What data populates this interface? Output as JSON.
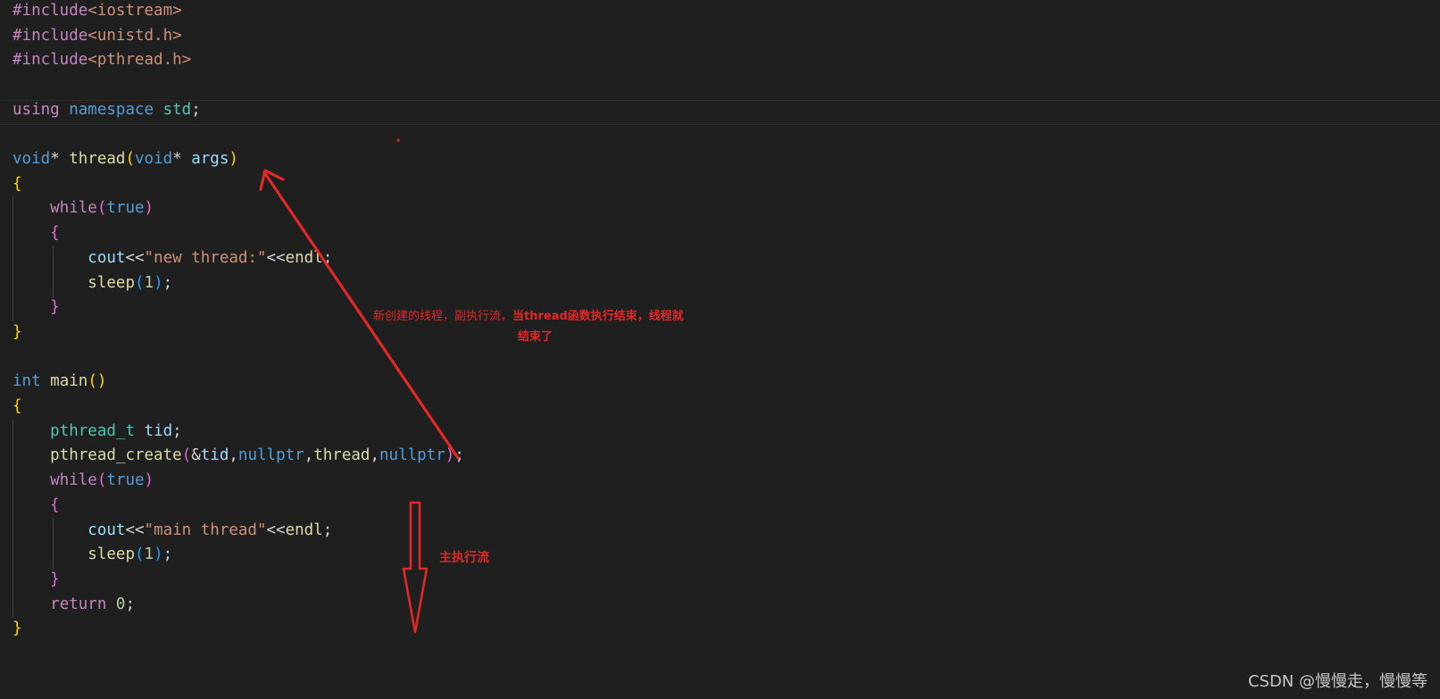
{
  "code": {
    "l1_kw": "#include",
    "l1_hdr": "<iostream>",
    "l2_kw": "#include",
    "l2_hdr": "<unistd.h>",
    "l3_kw": "#include",
    "l3_hdr": "<pthread.h>",
    "l5_using": "using",
    "l5_namespace": "namespace",
    "l5_std": "std",
    "l5_semi": ";",
    "l7_void1": "void",
    "l7_star1": "* ",
    "l7_thread": "thread",
    "l7_paren_open": "(",
    "l7_void2": "void",
    "l7_star2": "* ",
    "l7_args": "args",
    "l7_paren_close": ")",
    "brace_open": "{",
    "brace_close": "}",
    "while": "while",
    "true": "true",
    "paren_open": "(",
    "paren_close": ")",
    "cout": "cout",
    "shl": "<<",
    "str_new_thread": "\"new thread:\"",
    "endl": "endl",
    "semi": ";",
    "sleep": "sleep",
    "one": "1",
    "int": "int",
    "main": "main",
    "main_parens": "()",
    "pthread_t": "pthread_t",
    "tid": "tid",
    "pthread_create": "pthread_create",
    "amp": "&",
    "comma": ",",
    "nullptr": "nullptr",
    "thread": "thread",
    "str_main_thread": "\"main thread\"",
    "return": "return",
    "zero": "0"
  },
  "annotations": {
    "new_thread_note_part1": "新创建的线程，副执行流，",
    "new_thread_note_part2": "当thread函数执行结束，线程就",
    "new_thread_note_line2": "结束了",
    "main_flow_note": "主执行流"
  },
  "watermark": "CSDN @慢慢走，慢慢等",
  "colors": {
    "background": "#1f1f1f",
    "annotation": "#e02828"
  }
}
